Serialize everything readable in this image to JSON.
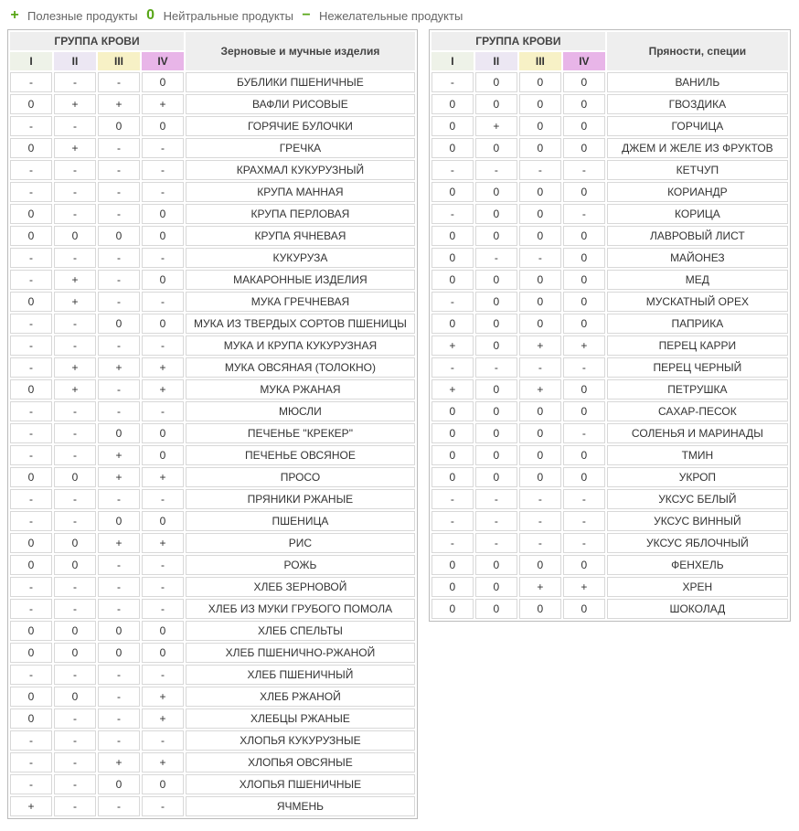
{
  "legend": {
    "plus": {
      "symbol": "+",
      "label": "Полезные продукты"
    },
    "zero": {
      "symbol": "0",
      "label": "Нейтральные продукты"
    },
    "minus": {
      "symbol": "−",
      "label": "Нежелательные продукты"
    }
  },
  "headers": {
    "group": "ГРУППА КРОВИ",
    "cols": [
      "I",
      "II",
      "III",
      "IV"
    ]
  },
  "tables": [
    {
      "title": "Зерновые и мучные изделия",
      "rows": [
        {
          "v": [
            "-",
            "-",
            "-",
            "0"
          ],
          "name": "БУБЛИКИ ПШЕНИЧНЫЕ"
        },
        {
          "v": [
            "0",
            "+",
            "+",
            "+"
          ],
          "name": "ВАФЛИ РИСОВЫЕ"
        },
        {
          "v": [
            "-",
            "-",
            "0",
            "0"
          ],
          "name": "ГОРЯЧИЕ БУЛОЧКИ"
        },
        {
          "v": [
            "0",
            "+",
            "-",
            "-"
          ],
          "name": "ГРЕЧКА"
        },
        {
          "v": [
            "-",
            "-",
            "-",
            "-"
          ],
          "name": "КРАХМАЛ КУКУРУЗНЫЙ"
        },
        {
          "v": [
            "-",
            "-",
            "-",
            "-"
          ],
          "name": "КРУПА МАННАЯ"
        },
        {
          "v": [
            "0",
            "-",
            "-",
            "0"
          ],
          "name": "КРУПА ПЕРЛОВАЯ"
        },
        {
          "v": [
            "0",
            "0",
            "0",
            "0"
          ],
          "name": "КРУПА ЯЧНЕВАЯ"
        },
        {
          "v": [
            "-",
            "-",
            "-",
            "-"
          ],
          "name": "КУКУРУЗА"
        },
        {
          "v": [
            "-",
            "+",
            "-",
            "0"
          ],
          "name": "МАКАРОННЫЕ ИЗДЕЛИЯ"
        },
        {
          "v": [
            "0",
            "+",
            "-",
            "-"
          ],
          "name": "МУКА ГРЕЧНЕВАЯ"
        },
        {
          "v": [
            "-",
            "-",
            "0",
            "0"
          ],
          "name": "МУКА ИЗ ТВЕРДЫХ СОРТОВ ПШЕНИЦЫ"
        },
        {
          "v": [
            "-",
            "-",
            "-",
            "-"
          ],
          "name": "МУКА И КРУПА КУКУРУЗНАЯ"
        },
        {
          "v": [
            "-",
            "+",
            "+",
            "+"
          ],
          "name": "МУКА ОВСЯНАЯ (ТОЛОКНО)"
        },
        {
          "v": [
            "0",
            "+",
            "-",
            "+"
          ],
          "name": "МУКА РЖАНАЯ"
        },
        {
          "v": [
            "-",
            "-",
            "-",
            "-"
          ],
          "name": "МЮСЛИ"
        },
        {
          "v": [
            "-",
            "-",
            "0",
            "0"
          ],
          "name": "ПЕЧЕНЬЕ \"КРЕКЕР\""
        },
        {
          "v": [
            "-",
            "-",
            "+",
            "0"
          ],
          "name": "ПЕЧЕНЬЕ ОВСЯНОЕ"
        },
        {
          "v": [
            "0",
            "0",
            "+",
            "+"
          ],
          "name": "ПРОСО"
        },
        {
          "v": [
            "-",
            "-",
            "-",
            "-"
          ],
          "name": "ПРЯНИКИ РЖАНЫЕ"
        },
        {
          "v": [
            "-",
            "-",
            "0",
            "0"
          ],
          "name": "ПШЕНИЦА"
        },
        {
          "v": [
            "0",
            "0",
            "+",
            "+"
          ],
          "name": "РИС"
        },
        {
          "v": [
            "0",
            "0",
            "-",
            "-"
          ],
          "name": "РОЖЬ"
        },
        {
          "v": [
            "-",
            "-",
            "-",
            "-"
          ],
          "name": "ХЛЕБ ЗЕРНОВОЙ"
        },
        {
          "v": [
            "-",
            "-",
            "-",
            "-"
          ],
          "name": "ХЛЕБ ИЗ МУКИ ГРУБОГО ПОМОЛА"
        },
        {
          "v": [
            "0",
            "0",
            "0",
            "0"
          ],
          "name": "ХЛЕБ СПЕЛЬТЫ"
        },
        {
          "v": [
            "0",
            "0",
            "0",
            "0"
          ],
          "name": "ХЛЕБ ПШЕНИЧНО-РЖАНОЙ"
        },
        {
          "v": [
            "-",
            "-",
            "-",
            "-"
          ],
          "name": "ХЛЕБ ПШЕНИЧНЫЙ"
        },
        {
          "v": [
            "0",
            "0",
            "-",
            "+"
          ],
          "name": "ХЛЕБ РЖАНОЙ"
        },
        {
          "v": [
            "0",
            "-",
            "-",
            "+"
          ],
          "name": "ХЛЕБЦЫ РЖАНЫЕ"
        },
        {
          "v": [
            "-",
            "-",
            "-",
            "-"
          ],
          "name": "ХЛОПЬЯ КУКУРУЗНЫЕ"
        },
        {
          "v": [
            "-",
            "-",
            "+",
            "+"
          ],
          "name": "ХЛОПЬЯ ОВСЯНЫЕ"
        },
        {
          "v": [
            "-",
            "-",
            "0",
            "0"
          ],
          "name": "ХЛОПЬЯ ПШЕНИЧНЫЕ"
        },
        {
          "v": [
            "+",
            "-",
            "-",
            "-"
          ],
          "name": "ЯЧМЕНЬ"
        }
      ]
    },
    {
      "title": "Пряности, специи",
      "rows": [
        {
          "v": [
            "-",
            "0",
            "0",
            "0"
          ],
          "name": "ВАНИЛЬ"
        },
        {
          "v": [
            "0",
            "0",
            "0",
            "0"
          ],
          "name": "ГВОЗДИКА"
        },
        {
          "v": [
            "0",
            "+",
            "0",
            "0"
          ],
          "name": "ГОРЧИЦА"
        },
        {
          "v": [
            "0",
            "0",
            "0",
            "0"
          ],
          "name": "ДЖЕМ И ЖЕЛЕ ИЗ ФРУКТОВ"
        },
        {
          "v": [
            "-",
            "-",
            "-",
            "-"
          ],
          "name": "КЕТЧУП"
        },
        {
          "v": [
            "0",
            "0",
            "0",
            "0"
          ],
          "name": "КОРИАНДР"
        },
        {
          "v": [
            "-",
            "0",
            "0",
            "-"
          ],
          "name": "КОРИЦА"
        },
        {
          "v": [
            "0",
            "0",
            "0",
            "0"
          ],
          "name": "ЛАВРОВЫЙ ЛИСТ"
        },
        {
          "v": [
            "0",
            "-",
            "-",
            "0"
          ],
          "name": "МАЙОНЕЗ"
        },
        {
          "v": [
            "0",
            "0",
            "0",
            "0"
          ],
          "name": "МЕД"
        },
        {
          "v": [
            "-",
            "0",
            "0",
            "0"
          ],
          "name": "МУСКАТНЫЙ ОРЕХ"
        },
        {
          "v": [
            "0",
            "0",
            "0",
            "0"
          ],
          "name": "ПАПРИКА"
        },
        {
          "v": [
            "+",
            "0",
            "+",
            "+"
          ],
          "name": "ПЕРЕЦ КАРРИ"
        },
        {
          "v": [
            "-",
            "-",
            "-",
            "-"
          ],
          "name": "ПЕРЕЦ ЧЕРНЫЙ"
        },
        {
          "v": [
            "+",
            "0",
            "+",
            "0"
          ],
          "name": "ПЕТРУШКА"
        },
        {
          "v": [
            "0",
            "0",
            "0",
            "0"
          ],
          "name": "САХАР-ПЕСОК"
        },
        {
          "v": [
            "0",
            "0",
            "0",
            "-"
          ],
          "name": "СОЛЕНЬЯ И МАРИНАДЫ"
        },
        {
          "v": [
            "0",
            "0",
            "0",
            "0"
          ],
          "name": "ТМИН"
        },
        {
          "v": [
            "0",
            "0",
            "0",
            "0"
          ],
          "name": "УКРОП"
        },
        {
          "v": [
            "-",
            "-",
            "-",
            "-"
          ],
          "name": "УКСУС БЕЛЫЙ"
        },
        {
          "v": [
            "-",
            "-",
            "-",
            "-"
          ],
          "name": "УКСУС ВИННЫЙ"
        },
        {
          "v": [
            "-",
            "-",
            "-",
            "-"
          ],
          "name": "УКСУС ЯБЛОЧНЫЙ"
        },
        {
          "v": [
            "0",
            "0",
            "0",
            "0"
          ],
          "name": "ФЕНХЕЛЬ"
        },
        {
          "v": [
            "0",
            "0",
            "+",
            "+"
          ],
          "name": "ХРЕН"
        },
        {
          "v": [
            "0",
            "0",
            "0",
            "0"
          ],
          "name": "ШОКОЛАД"
        }
      ]
    }
  ]
}
